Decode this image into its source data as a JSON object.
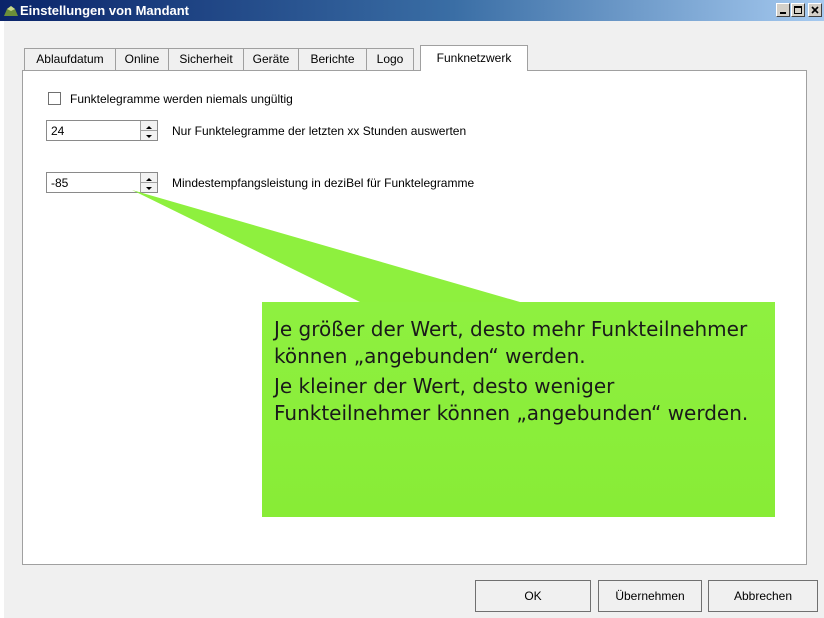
{
  "window": {
    "title": "Einstellungen von Mandant"
  },
  "tabs": [
    {
      "label": "Ablaufdatum"
    },
    {
      "label": "Online"
    },
    {
      "label": "Sicherheit"
    },
    {
      "label": "Geräte"
    },
    {
      "label": "Berichte"
    },
    {
      "label": "Logo"
    },
    {
      "label": "Funknetzwerk",
      "active": true
    }
  ],
  "funk": {
    "checkbox_label": "Funktelegramme werden niemals ungültig",
    "checkbox_checked": false,
    "hours_value": "24",
    "hours_label": "Nur Funktelegramme der letzten xx Stunden auswerten",
    "db_value": "-85",
    "db_label": "Mindestempfangsleistung in deziBel für Funktelegramme"
  },
  "callout": {
    "line1": "Je größer der Wert, desto mehr Funk­teilnehmer können „angebunden“ wer­den.",
    "line2": "Je kleiner der Wert, desto weniger Funkteilnehmer können „angebunden“ werden.",
    "color": "#8ef03e"
  },
  "buttons": {
    "ok": "OK",
    "apply": "Übernehmen",
    "cancel": "Abbrechen"
  }
}
